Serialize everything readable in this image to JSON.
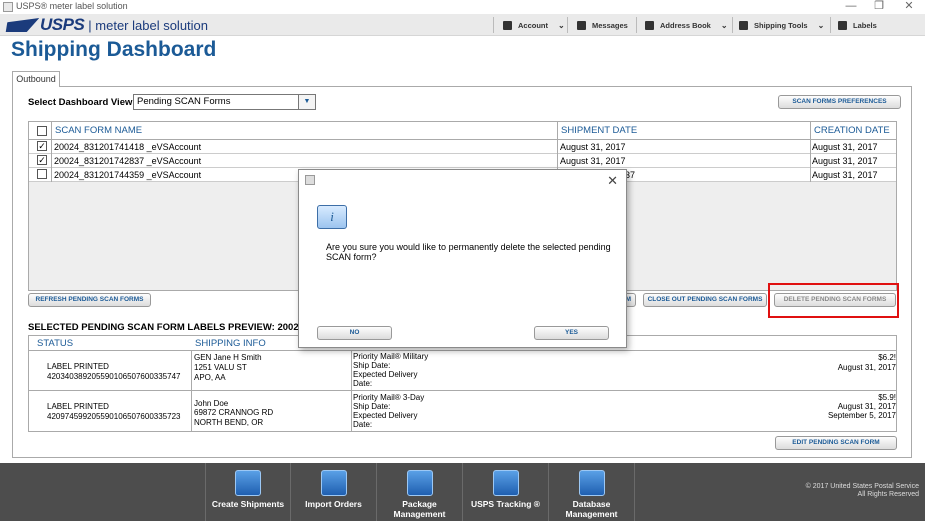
{
  "window": {
    "title": "USPS® meter label solution",
    "minimize": "—",
    "restore": "❐",
    "close": "✕"
  },
  "header": {
    "logo": "USPS",
    "product": "| meter label solution",
    "nav": [
      {
        "label": "Account",
        "chevron": "⌄"
      },
      {
        "label": "Messages"
      },
      {
        "label": "Address Book",
        "chevron": "⌄"
      },
      {
        "label": "Shipping Tools",
        "chevron": "⌄"
      },
      {
        "label": "Labels"
      }
    ]
  },
  "page": {
    "title": "Shipping Dashboard",
    "tab": "Outbound"
  },
  "dashboard_view": {
    "label": "Select Dashboard View:",
    "value": "Pending SCAN Forms",
    "arrow": "▼"
  },
  "buttons": {
    "scan_prefs": "SCAN FORMS PREFERENCES",
    "refresh": "REFRESH PENDING SCAN FORMS",
    "partial_m": "M",
    "close_out": "CLOSE OUT PENDING SCAN FORMS",
    "delete": "DELETE PENDING SCAN FORMS",
    "edit": "EDIT PENDING SCAN FORM"
  },
  "scan_table": {
    "headers": {
      "name": "SCAN FORM NAME",
      "shipment_date": "SHIPMENT DATE",
      "creation_date": "CREATION DATE"
    },
    "rows": [
      {
        "checked": true,
        "check": "✓",
        "name": "20024_831201741418 _eVSAccount",
        "shipment_date": "August 31, 2017",
        "creation_date": "August 31, 2017"
      },
      {
        "checked": true,
        "check": "✓",
        "name": "20024_831201742837 _eVSAccount",
        "shipment_date": "August 31, 2017",
        "creation_date": "August 31, 2017"
      },
      {
        "checked": false,
        "check": "",
        "name": "20024_831201744359 _eVSAccount",
        "shipment_date": "637",
        "creation_date": "August 31, 2017"
      }
    ]
  },
  "preview": {
    "title": "SELECTED PENDING SCAN FORM LABELS PREVIEW: 20024_83",
    "headers": {
      "status": "STATUS",
      "shipping_info": "SHIPPING INFO"
    },
    "rows": [
      {
        "status": "LABEL PRINTED",
        "tracking": "420340389205590106507600335747",
        "addr1": "GEN Jane H Smith",
        "addr2": "1251 VALU ST",
        "addr3": "APO, AA",
        "service": "Priority Mail® Military",
        "ship_date_label": "Ship Date:",
        "expected_label": "Expected Delivery",
        "date_label": "Date:",
        "price": "$6.2!",
        "ship_date": "August 31, 2017",
        "expected": ""
      },
      {
        "status": "LABEL PRINTED",
        "tracking": "420974599205590106507600335723",
        "addr1": "John Doe",
        "addr2": "69872 CRANNOG RD",
        "addr3": "NORTH BEND, OR",
        "service": "Priority Mail® 3-Day",
        "ship_date_label": "Ship Date:",
        "expected_label": "Expected Delivery",
        "date_label": "Date:",
        "price": "$5.9!",
        "ship_date": "August 31, 2017",
        "expected": "September 5, 2017"
      }
    ]
  },
  "dialog": {
    "icon": "i",
    "close": "✕",
    "message": "Are you sure you would like to permanently delete the selected pending SCAN form?",
    "no": "NO",
    "yes": "YES"
  },
  "bottom_nav": [
    {
      "label": "Create Shipments",
      "icon": "create-shipments-icon"
    },
    {
      "label": "Import Orders",
      "icon": "import-orders-icon"
    },
    {
      "label": "Package Management",
      "icon": "package-management-icon"
    },
    {
      "label": "USPS Tracking ®",
      "icon": "tracking-icon"
    },
    {
      "label": "Database Management",
      "icon": "database-icon"
    }
  ],
  "footer": {
    "line1": "© 2017 United States Postal Service",
    "line2": "All Rights Reserved"
  },
  "colors": {
    "accent": "#1b5a96",
    "highlight": "#e01010",
    "bottombar": "#4d4d4d"
  }
}
